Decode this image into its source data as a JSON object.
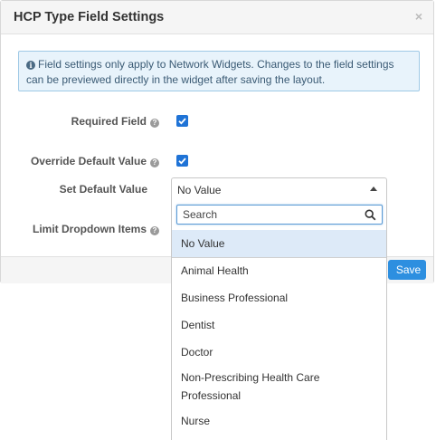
{
  "dialog": {
    "title": "HCP Type Field Settings",
    "close_symbol": "×",
    "info_text": "Field settings only apply to Network Widgets. Changes to the field settings can be previewed directly in the widget after saving the layout.",
    "info_icon": "i",
    "help_symbol": "?"
  },
  "form": {
    "required_label": "Required Field",
    "required_checked": true,
    "override_label": "Override Default Value",
    "override_checked": true,
    "set_default_label": "Set Default Value",
    "limit_dropdown_label": "Limit Dropdown Items"
  },
  "select": {
    "value": "No Value",
    "search_placeholder": "Search",
    "options": [
      {
        "label": "No Value",
        "selected": true
      },
      {
        "label": "Animal Health",
        "selected": false
      },
      {
        "label": "Business Professional",
        "selected": false
      },
      {
        "label": "Dentist",
        "selected": false
      },
      {
        "label": "Doctor",
        "selected": false
      },
      {
        "label": "Non-Prescribing Health Care Professional",
        "selected": false
      },
      {
        "label": "Nurse",
        "selected": false
      }
    ]
  },
  "footer": {
    "save_label": "Save"
  },
  "colors": {
    "accent": "#1f73d6",
    "save_button": "#2d8fe0",
    "info_bg": "#e8f3fb",
    "selected_option_bg": "#ddeaf8"
  }
}
